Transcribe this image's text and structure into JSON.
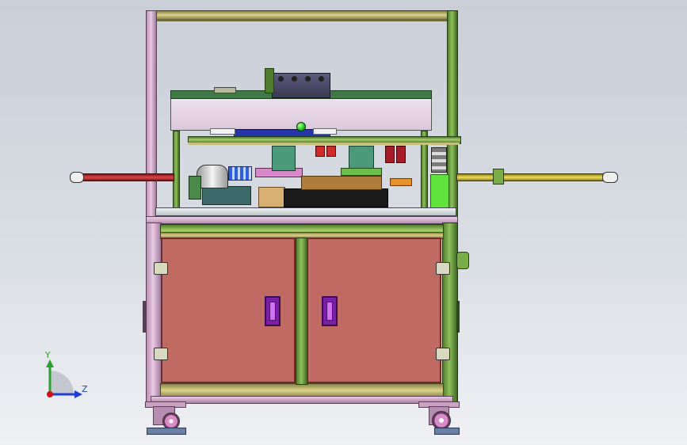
{
  "viewport": {
    "background_top": "#c9ced7",
    "background_bottom": "#eef0f3"
  },
  "triad": {
    "y_label": "Y",
    "z_label": "Z",
    "y_color": "#2ca02c",
    "z_color": "#1f3fd0",
    "x_color": "#d01010"
  },
  "colors": {
    "frame_pink": "#d8b4d2",
    "frame_green": "#7aad48",
    "beam_tan": "#c7c07a",
    "door": "#c06a64",
    "handle": "#8a2ab8",
    "rail_red": "#d83a3a",
    "rail_yellow": "#e8d44c",
    "hood": "#e8d8ea",
    "control_box": "#4a4a66"
  },
  "icons": {
    "triad": "coordinate-triad-icon",
    "status_lamp": "green-status-lamp-icon"
  }
}
